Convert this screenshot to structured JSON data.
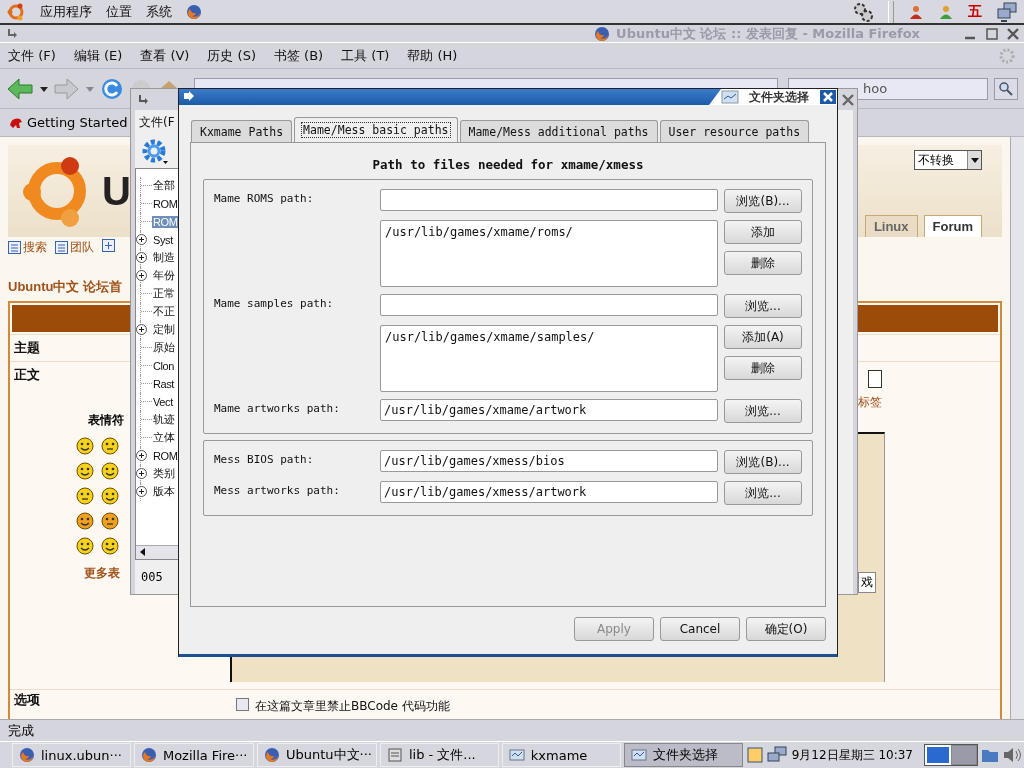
{
  "top_panel": {
    "menus": [
      "应用程序",
      "位置",
      "系统"
    ],
    "tray_text": "五"
  },
  "browser": {
    "title": "Ubuntu中文 论坛 :: 发表回复 - Mozilla Firefox",
    "menus": [
      "文件 (F)",
      "编辑 (E)",
      "查看 (V)",
      "历史 (S)",
      "书签 (B)",
      "工具 (T)",
      "帮助 (H)"
    ],
    "search_value": "hoo",
    "bookmarks": [
      "Getting Started"
    ],
    "page": {
      "logo_text": "U",
      "encoding_select": "不转换",
      "site_tabs": [
        {
          "label": "Linux",
          "selected": false
        },
        {
          "label": "Forum",
          "selected": true
        }
      ],
      "links": [
        "搜索",
        "团队"
      ],
      "breadcrumb": "Ubuntu中文 论坛首",
      "subject_label": "主题",
      "body_label": "正文",
      "smilies_heading": "表情符",
      "more_smilies": "更多表",
      "side_link": "标签",
      "side_button": "戏",
      "options_label": "选项",
      "options": [
        {
          "label": "在这篇文章里禁止BBCode 代码功能",
          "checked": false
        }
      ]
    },
    "status": "完成"
  },
  "kxmame": {
    "menus": [
      "文件(F"
    ],
    "tree": [
      {
        "label": "全部",
        "expandable": false,
        "selected": false
      },
      {
        "label": "ROM",
        "expandable": false,
        "selected": false
      },
      {
        "label": "ROM",
        "expandable": false,
        "selected": true
      },
      {
        "label": "Syst",
        "expandable": true,
        "selected": false
      },
      {
        "label": "制造",
        "expandable": true,
        "selected": false
      },
      {
        "label": "年份",
        "expandable": true,
        "selected": false
      },
      {
        "label": "正常",
        "expandable": false,
        "selected": false
      },
      {
        "label": "不正",
        "expandable": false,
        "selected": false
      },
      {
        "label": "定制",
        "expandable": true,
        "selected": false
      },
      {
        "label": "原始",
        "expandable": false,
        "selected": false
      },
      {
        "label": "Clon",
        "expandable": false,
        "selected": false
      },
      {
        "label": "Rast",
        "expandable": false,
        "selected": false
      },
      {
        "label": "Vect",
        "expandable": false,
        "selected": false
      },
      {
        "label": "轨迹",
        "expandable": false,
        "selected": false
      },
      {
        "label": "立体",
        "expandable": false,
        "selected": false
      },
      {
        "label": "ROM",
        "expandable": true,
        "selected": false
      },
      {
        "label": "类别",
        "expandable": true,
        "selected": false
      },
      {
        "label": "版本",
        "expandable": true,
        "selected": false
      }
    ],
    "status": "005"
  },
  "dialog": {
    "title": "文件夹选择",
    "tabs": [
      {
        "label": "Kxmame Paths",
        "selected": false
      },
      {
        "label": "Mame/Mess basic paths",
        "selected": true
      },
      {
        "label": "Mame/Mess additional paths",
        "selected": false
      },
      {
        "label": "User resource paths",
        "selected": false
      }
    ],
    "heading": "Path to files needed for xmame/xmess",
    "groups": [
      {
        "rows": [
          {
            "kind": "field",
            "label": "Mame ROMS path:",
            "button": "浏览(B)..."
          },
          {
            "kind": "list",
            "items": [
              "/usr/lib/games/xmame/roms/"
            ],
            "buttons": [
              "添加",
              "删除"
            ]
          },
          {
            "kind": "field",
            "label": "Mame samples path:",
            "button": "浏览..."
          },
          {
            "kind": "list",
            "items": [
              "/usr/lib/games/xmame/samples/"
            ],
            "buttons": [
              "添加(A)",
              "删除"
            ]
          },
          {
            "kind": "field",
            "label": "Mame artworks path:",
            "value": "/usr/lib/games/xmame/artwork",
            "button": "浏览..."
          }
        ]
      },
      {
        "rows": [
          {
            "kind": "field",
            "label": "Mess BIOS path:",
            "value": "/usr/lib/games/xmess/bios",
            "button": "浏览(B)..."
          },
          {
            "kind": "field",
            "label": "Mess artworks path:",
            "value": "/usr/lib/games/xmess/artwork",
            "button": "浏览..."
          }
        ]
      }
    ],
    "buttons": [
      {
        "label": "Apply",
        "disabled": true
      },
      {
        "label": "Cancel",
        "disabled": false
      },
      {
        "label": "确定(O)",
        "disabled": false
      }
    ]
  },
  "taskbar": {
    "items": [
      {
        "label": "linux.ubun···",
        "kind": "browser",
        "selected": false
      },
      {
        "label": "Mozilla Fire···",
        "kind": "browser",
        "selected": false
      },
      {
        "label": "Ubuntu中文···",
        "kind": "browser",
        "selected": false
      },
      {
        "label": "lib - 文件...",
        "kind": "folder",
        "selected": false
      },
      {
        "label": "kxmame",
        "kind": "app",
        "selected": false
      },
      {
        "label": "文件夹选择",
        "kind": "app",
        "selected": true
      }
    ],
    "clock": "9月12日星期三 10:37",
    "workspaces": [
      {
        "selected": true
      },
      {
        "selected": false
      }
    ]
  }
}
